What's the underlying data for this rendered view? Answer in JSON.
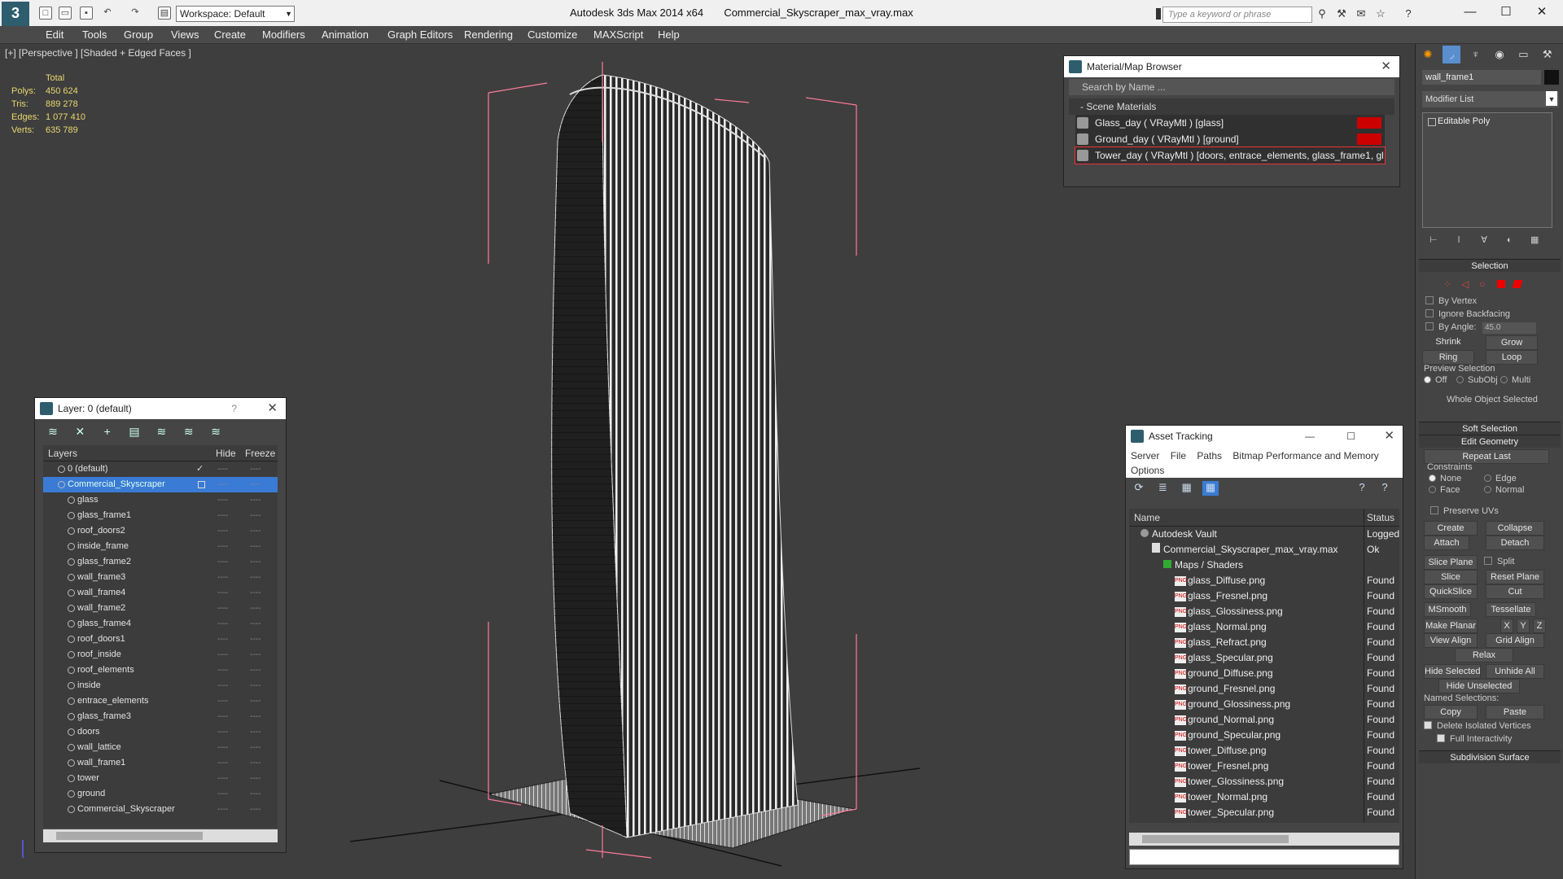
{
  "titlebar": {
    "workspace": "Workspace: Default",
    "app": "Autodesk 3ds Max  2014 x64",
    "file": "Commercial_Skyscraper_max_vray.max",
    "search_placeholder": "Type a keyword or phrase",
    "logo": "3"
  },
  "menu": [
    "Edit",
    "Tools",
    "Group",
    "Views",
    "Create",
    "Modifiers",
    "Animation",
    "Graph Editors",
    "Rendering",
    "Customize",
    "MAXScript",
    "Help"
  ],
  "viewport": {
    "label": "[+] [Perspective ] [Shaded + Edged Faces ]",
    "stats": {
      "header": "Total",
      "polys_label": "Polys:",
      "polys": "450 624",
      "tris_label": "Tris:",
      "tris": "889 278",
      "edges_label": "Edges:",
      "edges": "1 077 410",
      "verts_label": "Verts:",
      "verts": "635 789"
    }
  },
  "layer_explorer": {
    "title": "Layer: 0 (default)",
    "col_layers": "Layers",
    "col_hide": "Hide",
    "col_freeze": "Freeze",
    "dash": "----",
    "rows": [
      {
        "name": "0 (default)",
        "level": 0
      },
      {
        "name": "Commercial_Skyscraper",
        "level": 0
      },
      {
        "name": "glass",
        "level": 1
      },
      {
        "name": "glass_frame1",
        "level": 1
      },
      {
        "name": "roof_doors2",
        "level": 1
      },
      {
        "name": "inside_frame",
        "level": 1
      },
      {
        "name": "glass_frame2",
        "level": 1
      },
      {
        "name": "wall_frame3",
        "level": 1
      },
      {
        "name": "wall_frame4",
        "level": 1
      },
      {
        "name": "wall_frame2",
        "level": 1
      },
      {
        "name": "glass_frame4",
        "level": 1
      },
      {
        "name": "roof_doors1",
        "level": 1
      },
      {
        "name": "roof_inside",
        "level": 1
      },
      {
        "name": "roof_elements",
        "level": 1
      },
      {
        "name": "inside",
        "level": 1
      },
      {
        "name": "entrace_elements",
        "level": 1
      },
      {
        "name": "glass_frame3",
        "level": 1
      },
      {
        "name": "doors",
        "level": 1
      },
      {
        "name": "wall_lattice",
        "level": 1
      },
      {
        "name": "wall_frame1",
        "level": 1
      },
      {
        "name": "tower",
        "level": 1
      },
      {
        "name": "ground",
        "level": 1
      },
      {
        "name": "Commercial_Skyscraper",
        "level": 1
      }
    ]
  },
  "material_browser": {
    "title": "Material/Map Browser",
    "search": "Search by Name ...",
    "section": "- Scene Materials",
    "materials": [
      "Glass_day  ( VRayMtl ) [glass]",
      "Ground_day  ( VRayMtl ) [ground]",
      "Tower_day  ( VRayMtl ) [doors, entrace_elements, glass_frame1, gl..."
    ]
  },
  "asset_tracking": {
    "title": "Asset Tracking",
    "menu": [
      "Server",
      "File",
      "Paths",
      "Bitmap Performance and Memory",
      "Options"
    ],
    "col_name": "Name",
    "col_status": "Status",
    "rows": [
      {
        "name": "Autodesk Vault",
        "status": "Logged",
        "indent": 0
      },
      {
        "name": "Commercial_Skyscraper_max_vray.max",
        "status": "Ok",
        "indent": 1
      },
      {
        "name": "Maps / Shaders",
        "status": "",
        "indent": 2
      },
      {
        "name": "glass_Diffuse.png",
        "status": "Found",
        "indent": 3
      },
      {
        "name": "glass_Fresnel.png",
        "status": "Found",
        "indent": 3
      },
      {
        "name": "glass_Glossiness.png",
        "status": "Found",
        "indent": 3
      },
      {
        "name": "glass_Normal.png",
        "status": "Found",
        "indent": 3
      },
      {
        "name": "glass_Refract.png",
        "status": "Found",
        "indent": 3
      },
      {
        "name": "glass_Specular.png",
        "status": "Found",
        "indent": 3
      },
      {
        "name": "ground_Diffuse.png",
        "status": "Found",
        "indent": 3
      },
      {
        "name": "ground_Fresnel.png",
        "status": "Found",
        "indent": 3
      },
      {
        "name": "ground_Glossiness.png",
        "status": "Found",
        "indent": 3
      },
      {
        "name": "ground_Normal.png",
        "status": "Found",
        "indent": 3
      },
      {
        "name": "ground_Specular.png",
        "status": "Found",
        "indent": 3
      },
      {
        "name": "tower_Diffuse.png",
        "status": "Found",
        "indent": 3
      },
      {
        "name": "tower_Fresnel.png",
        "status": "Found",
        "indent": 3
      },
      {
        "name": "tower_Glossiness.png",
        "status": "Found",
        "indent": 3
      },
      {
        "name": "tower_Normal.png",
        "status": "Found",
        "indent": 3
      },
      {
        "name": "tower_Specular.png",
        "status": "Found",
        "indent": 3
      }
    ]
  },
  "command_panel": {
    "object_name": "wall_frame1",
    "modifier_list": "Modifier List",
    "stack_item": "Editable Poly",
    "selection": {
      "title": "Selection",
      "by_vertex": "By Vertex",
      "ignore_backfacing": "Ignore Backfacing",
      "by_angle": "By Angle:",
      "angle": "45.0",
      "shrink": "Shrink",
      "grow": "Grow",
      "ring": "Ring",
      "loop": "Loop",
      "preview": "Preview Selection",
      "off": "Off",
      "subobj": "SubObj",
      "multi": "Multi",
      "whole": "Whole Object Selected"
    },
    "soft_selection": "Soft Selection",
    "edit_geometry": {
      "title": "Edit Geometry",
      "repeat_last": "Repeat Last",
      "constraints": "Constraints",
      "none": "None",
      "edge": "Edge",
      "face": "Face",
      "normal": "Normal",
      "preserve_uvs": "Preserve UVs",
      "create": "Create",
      "collapse": "Collapse",
      "attach": "Attach",
      "detach": "Detach",
      "slice_plane": "Slice Plane",
      "split": "Split",
      "slice": "Slice",
      "reset_plane": "Reset Plane",
      "quickslice": "QuickSlice",
      "cut": "Cut",
      "msmooth": "MSmooth",
      "tessellate": "Tessellate",
      "make_planar": "Make Planar",
      "x": "X",
      "y": "Y",
      "z": "Z",
      "view_align": "View Align",
      "grid_align": "Grid Align",
      "relax": "Relax",
      "hide_selected": "Hide Selected",
      "unhide_all": "Unhide All",
      "hide_unselected": "Hide Unselected",
      "named_selections": "Named Selections:",
      "copy": "Copy",
      "paste": "Paste",
      "delete_isolated": "Delete Isolated Vertices",
      "full_interactivity": "Full Interactivity"
    },
    "subdivision_surface": "Subdivision Surface"
  }
}
